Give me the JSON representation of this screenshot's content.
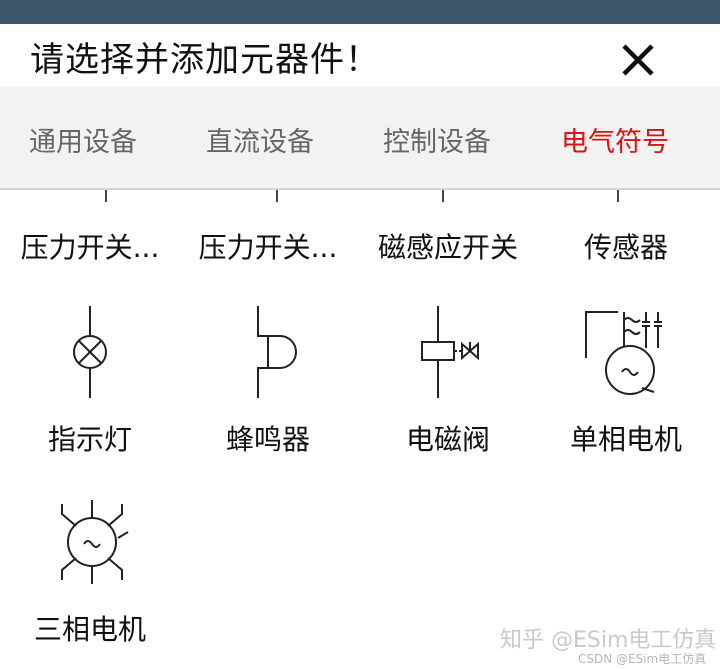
{
  "header": {
    "title": "请选择并添加元器件！"
  },
  "tabs": [
    {
      "label": "通用设备",
      "active": false
    },
    {
      "label": "直流设备",
      "active": false
    },
    {
      "label": "控制设备",
      "active": false
    },
    {
      "label": "电气符号",
      "active": true
    }
  ],
  "colors": {
    "status_bar": "#3d5568",
    "active_tab": "#e01010",
    "tab_bar": "#f2f2f2"
  },
  "components": [
    {
      "label": "压力开关...",
      "icon": "pressure-switch-icon"
    },
    {
      "label": "压力开关...",
      "icon": "pressure-switch-icon"
    },
    {
      "label": "磁感应开关",
      "icon": "magnetic-switch-icon"
    },
    {
      "label": "传感器",
      "icon": "sensor-icon"
    },
    {
      "label": "指示灯",
      "icon": "indicator-lamp-icon"
    },
    {
      "label": "蜂鸣器",
      "icon": "buzzer-icon"
    },
    {
      "label": "电磁阀",
      "icon": "solenoid-valve-icon"
    },
    {
      "label": "单相电机",
      "icon": "single-phase-motor-icon"
    },
    {
      "label": "三相电机",
      "icon": "three-phase-motor-icon"
    }
  ],
  "watermark": {
    "main": "知乎 @ESim电工仿真",
    "sub": "CSDN @ESim电工仿真"
  }
}
